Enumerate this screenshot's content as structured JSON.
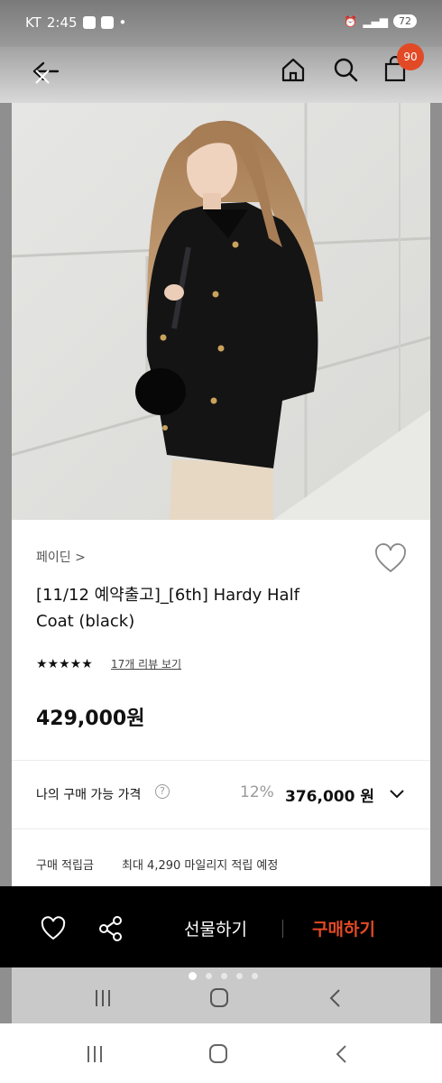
{
  "status_bar": {
    "carrier": "KT",
    "time": "2:45",
    "battery": "72"
  },
  "header": {
    "cart_count": "90"
  },
  "product": {
    "brand": "페이딘 >",
    "title_line1": "[11/12 예약출고]_[6th] Hardy Half",
    "title_line2": "Coat (black)",
    "stars": "★★★★★",
    "reviews_link": "17개 리뷰 보기",
    "price": "429,000원"
  },
  "buy_price": {
    "label": "나의 구매 가능 가격",
    "help_icon": "?",
    "discount": "12%",
    "discounted_price": "376,000 원"
  },
  "points": {
    "label": "구매 적립금",
    "text": "최대 4,290 마일리지 적립 예정"
  },
  "action_bar": {
    "gift_label": "선물하기",
    "buy_label": "구매하기"
  },
  "icons": {
    "back": "back-icon",
    "home": "home-icon",
    "search": "search-icon",
    "bag": "shopping-bag-icon",
    "wishlist": "heart-icon",
    "share": "share-icon"
  },
  "colors": {
    "accent": "#e24a25",
    "action_bar_bg": "#000000"
  }
}
